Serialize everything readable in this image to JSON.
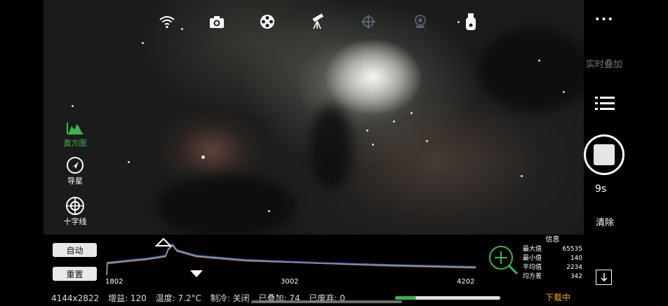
{
  "left_tools": [
    {
      "label": "直方图",
      "icon": "histogram-icon",
      "active": true
    },
    {
      "label": "导星",
      "icon": "guide-arrow-icon",
      "active": false
    },
    {
      "label": "十字线",
      "icon": "crosshair-icon",
      "active": false
    }
  ],
  "right_panel": {
    "more_label": "•••",
    "live_stack_label": "实时叠加",
    "timer": "9s",
    "clear_label": "清除",
    "download_status": "下载中"
  },
  "histogram": {
    "auto_label": "自动",
    "reset_label": "重置",
    "ticks": [
      "1802",
      "3002",
      "4202"
    ]
  },
  "stats": {
    "title": "信息",
    "rows": [
      {
        "label": "最大值",
        "value": "65535"
      },
      {
        "label": "最小值",
        "value": "140"
      },
      {
        "label": "平均值",
        "value": "2234"
      },
      {
        "label": "均方差",
        "value": "342"
      }
    ]
  },
  "status_bar": {
    "resolution": "4144x2822",
    "gain": "增益: 120",
    "temp": "温度: 7.2°C",
    "cooling": "制冷: 关闭",
    "stacked": "已叠加: 74",
    "discarded": "已废弃: 0",
    "progress": 0.2
  },
  "colors": {
    "accent_green": "#3cb54a",
    "accent_orange": "#f5a623"
  }
}
